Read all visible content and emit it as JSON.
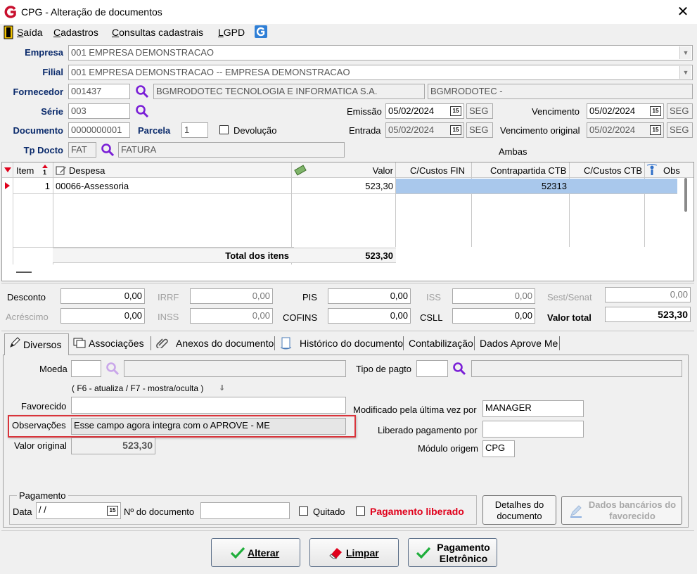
{
  "window": {
    "title": "CPG - Alteração de documentos",
    "icon": "app-g-icon",
    "close": "✕"
  },
  "menu": [
    {
      "label": "Saída",
      "key": "S",
      "rest": "aída"
    },
    {
      "label": "Cadastros",
      "key": "C",
      "rest": "adastros"
    },
    {
      "label": "Consultas cadastrais",
      "key": "C",
      "rest": "onsultas cadastrais"
    },
    {
      "label": "LGPD",
      "key": "L",
      "rest": "GPD"
    }
  ],
  "header": {
    "empresa_label": "Empresa",
    "empresa_value": "001 EMPRESA DEMONSTRACAO",
    "filial_label": "Filial",
    "filial_value": "001 EMPRESA DEMONSTRACAO -- EMPRESA DEMONSTRACAO",
    "fornecedor_label": "Fornecedor",
    "fornecedor_code": "001437",
    "fornecedor_name": "BGMRODOTEC TECNOLOGIA E INFORMATICA S.A.",
    "fornecedor_short": "BGMRODOTEC -",
    "serie_label": "Série",
    "serie_value": "003",
    "documento_label": "Documento",
    "documento_value": "0000000001",
    "parcela_label": "Parcela",
    "parcela_value": "1",
    "devolucao_label": "Devolução",
    "tpdocto_label": "Tp Docto",
    "tpdocto_code": "FAT",
    "tpdocto_desc": "FATURA",
    "emissao_label": "Emissão",
    "emissao_value": "05/02/2024",
    "emissao_dow": "SEG",
    "entrada_label": "Entrada",
    "entrada_value": "05/02/2024",
    "entrada_dow": "SEG",
    "vencimento_label": "Vencimento",
    "vencimento_value": "05/02/2024",
    "vencimento_dow": "SEG",
    "venc_original_label": "Vencimento original",
    "venc_original_value": "05/02/2024",
    "venc_original_dow": "SEG",
    "ambas_label": "Ambas",
    "cal_text": "15"
  },
  "grid": {
    "columns": [
      "Item",
      "Despesa",
      "Valor",
      "C/Custos FIN",
      "Contrapartida CTB",
      "C/Custos CTB",
      "Obs"
    ],
    "rows": [
      {
        "item": "1",
        "despesa": "00066-Assessoria",
        "valor": "523,30",
        "ccfin": "",
        "contrapartida": "52313",
        "ccctb": "",
        "obs": ""
      }
    ],
    "total_label": "Total dos itens",
    "total_value": "523,30",
    "item_sort": "1"
  },
  "totals": {
    "desconto_label": "Desconto",
    "desconto": "0,00",
    "acrescimo_label": "Acréscimo",
    "acrescimo": "0,00",
    "irrf_label": "IRRF",
    "irrf": "0,00",
    "inss_label": "INSS",
    "inss": "0,00",
    "pis_label": "PIS",
    "pis": "0,00",
    "cofins_label": "COFINS",
    "cofins": "0,00",
    "iss_label": "ISS",
    "iss": "0,00",
    "csll_label": "CSLL",
    "csll": "0,00",
    "sest_label": "Sest/Senat",
    "sest": "0,00",
    "valor_total_label": "Valor total",
    "valor_total": "523,30"
  },
  "tabs": [
    {
      "label": "Diversos",
      "icon": "pencil-icon"
    },
    {
      "label": "Associações",
      "icon": "folder-icon"
    },
    {
      "label": "Anexos do documento",
      "icon": "paperclip-icon"
    },
    {
      "label": "Histórico do documento",
      "icon": "document-icon"
    },
    {
      "label": "Contabilização"
    },
    {
      "label": "Dados Aprove Me"
    }
  ],
  "diversos": {
    "moeda_label": "Moeda",
    "tipo_pagto_label": "Tipo de pagto",
    "hint": "( F6 - atualiza / F7 - mostra/oculta )",
    "favorecido_label": "Favorecido",
    "observacoes_label": "Observações",
    "observacoes_value": "Esse campo agora integra com o APROVE - ME",
    "valor_original_label": "Valor original",
    "valor_original_value": "523,30",
    "modificado_label": "Modificado pela última vez por",
    "modificado_value": "MANAGER",
    "liberado_label": "Liberado pagamento por",
    "liberado_value": "",
    "modulo_label": "Módulo origem",
    "modulo_value": "CPG"
  },
  "pagamento": {
    "group_label": "Pagamento",
    "data_label": "Data",
    "data_value": " /  /",
    "ndoc_label": "Nº do documento",
    "quitado_label": "Quitado",
    "liberado_label": "Pagamento liberado",
    "detalhes_label": "Detalhes do documento",
    "dados_bancarios_label": "Dados bancários do favorecido"
  },
  "actions": {
    "alterar": "Alterar",
    "limpar": "Limpar",
    "pagamento_eletronico": "Pagamento Eletrônico"
  },
  "colors": {
    "label_blue": "#0a2a6b",
    "select_row": "#a9c8ec",
    "red": "#e0001b",
    "purple_icon": "#7a1fd6",
    "green_check": "#1fae3b"
  }
}
